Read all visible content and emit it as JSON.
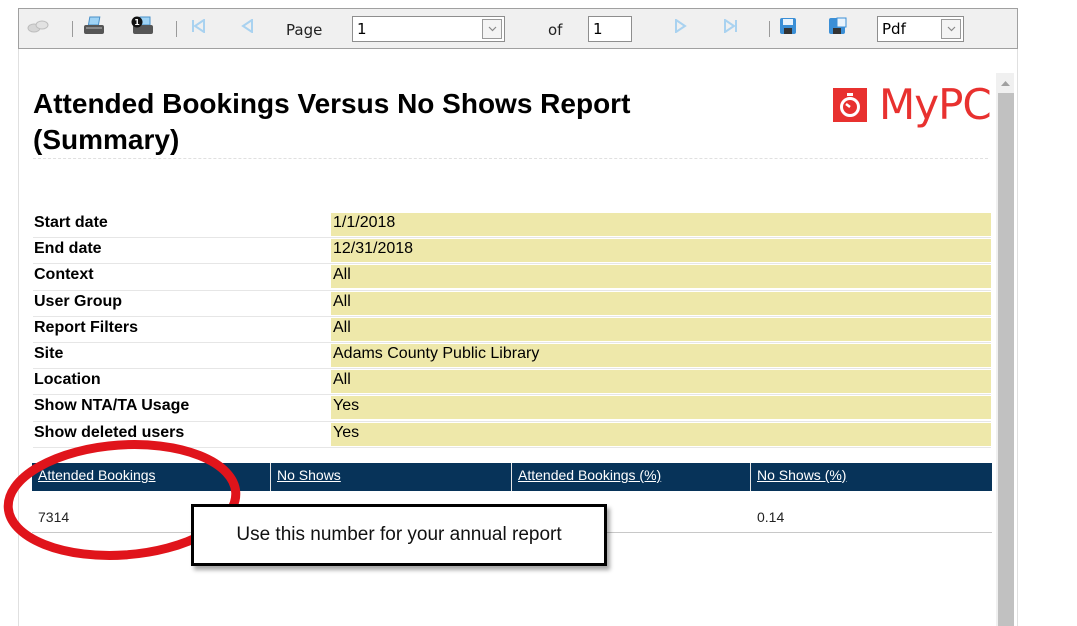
{
  "toolbar": {
    "page_label": "Page",
    "page_value": "1",
    "of_label": "of",
    "total_pages": "1",
    "export_format": "Pdf",
    "icons": [
      "find-icon",
      "print-icon",
      "print-page-icon",
      "first-page-icon",
      "previous-page-icon",
      "next-page-icon",
      "last-page-icon",
      "save-icon",
      "save-as-icon"
    ]
  },
  "report": {
    "title": "Attended Bookings Versus No Shows Report (Summary)",
    "logo_text": "MyPC",
    "brand_color": "#e8312f",
    "parameters": [
      {
        "label": "Start date",
        "value": "1/1/2018"
      },
      {
        "label": "End date",
        "value": "12/31/2018"
      },
      {
        "label": "Context",
        "value": "All"
      },
      {
        "label": "User Group",
        "value": "All"
      },
      {
        "label": "Report Filters",
        "value": "All"
      },
      {
        "label": "Site",
        "value": "Adams County Public Library"
      },
      {
        "label": "Location",
        "value": "All"
      },
      {
        "label": "Show NTA/TA Usage",
        "value": "Yes"
      },
      {
        "label": "Show deleted users",
        "value": "Yes"
      }
    ],
    "results": {
      "headers": [
        "Attended Bookings",
        "No Shows",
        "Attended Bookings (%)",
        "No Shows (%)"
      ],
      "row": [
        "7314",
        "",
        "",
        "0.14"
      ]
    }
  },
  "annotation": {
    "callout_text": "Use this number for your annual report",
    "highlight_color": "#e0141b"
  }
}
